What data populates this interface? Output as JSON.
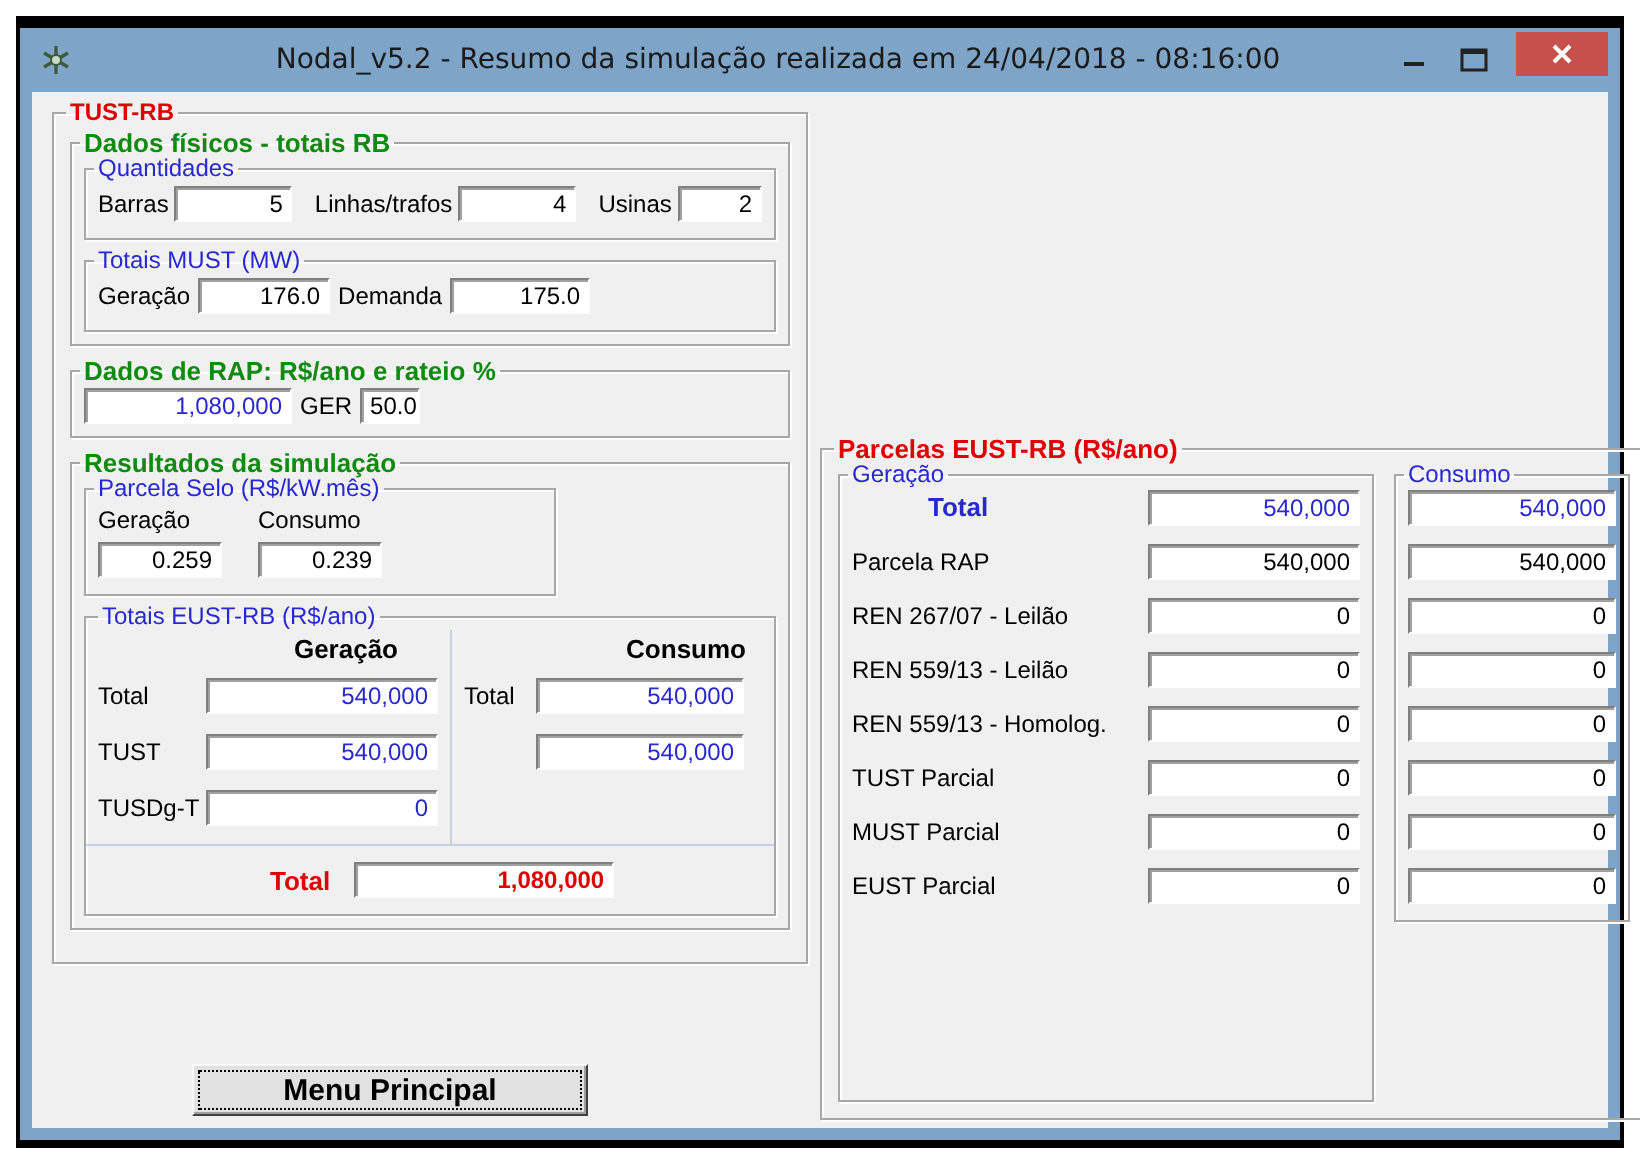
{
  "window": {
    "title": "Nodal_v5.2 - Resumo da simulação realizada em 24/04/2018 - 08:16:00"
  },
  "tust_rb": {
    "title": "TUST-RB",
    "dados_fisicos": {
      "title": "Dados físicos - totais RB",
      "quantidades": {
        "title": "Quantidades",
        "fields": [
          {
            "label": "Barras",
            "value": "5"
          },
          {
            "label": "Linhas/trafos",
            "value": "4"
          },
          {
            "label": "Usinas",
            "value": "2"
          }
        ]
      },
      "totais_must": {
        "title": "Totais MUST (MW)",
        "fields": [
          {
            "label": "Geração",
            "value": "176.0"
          },
          {
            "label": "Demanda",
            "value": "175.0"
          }
        ]
      }
    },
    "dados_rap": {
      "title": "Dados de RAP: R$/ano e rateio %",
      "value": "1,080,000",
      "ger_label": "GER",
      "ger_value": "50.0"
    },
    "resultados": {
      "title": "Resultados da simulação",
      "parcela_selo": {
        "title": "Parcela Selo (R$/kW.mês)",
        "columns": [
          {
            "label": "Geração",
            "value": "0.259"
          },
          {
            "label": "Consumo",
            "value": "0.239"
          }
        ]
      },
      "totais_eust": {
        "title": "Totais EUST-RB  (R$/ano)",
        "geracao": {
          "heading": "Geração",
          "rows": [
            {
              "label": "Total",
              "value": "540,000"
            },
            {
              "label": "TUST",
              "value": "540,000"
            },
            {
              "label": "TUSDg-T",
              "value": "0"
            }
          ]
        },
        "consumo": {
          "heading": "Consumo",
          "rows": [
            {
              "label": "Total",
              "value": "540,000"
            },
            {
              "value": "540,000"
            }
          ]
        },
        "total": {
          "label": "Total",
          "value": "1,080,000"
        }
      }
    }
  },
  "parcelas": {
    "title": "Parcelas EUST-RB (R$/ano)",
    "geracao": {
      "title": "Geração",
      "rows": [
        {
          "kind": "total",
          "label": "Total",
          "value": "540,000"
        },
        {
          "kind": "item",
          "label": "Parcela RAP",
          "value": "540,000"
        },
        {
          "kind": "item",
          "label": "REN 267/07 - Leilão",
          "value": "0"
        },
        {
          "kind": "item",
          "label": "REN 559/13 - Leilão",
          "value": "0"
        },
        {
          "kind": "item",
          "label": "REN 559/13 - Homolog.",
          "value": "0"
        },
        {
          "kind": "item",
          "label": "TUST Parcial",
          "value": "0"
        },
        {
          "kind": "item",
          "label": "MUST Parcial",
          "value": "0"
        },
        {
          "kind": "item",
          "label": "EUST Parcial",
          "value": "0"
        }
      ]
    },
    "consumo": {
      "title": "Consumo",
      "rows": [
        {
          "kind": "total",
          "value": "540,000"
        },
        {
          "kind": "item",
          "value": "540,000"
        },
        {
          "kind": "item",
          "value": "0"
        },
        {
          "kind": "item",
          "value": "0"
        },
        {
          "kind": "item",
          "value": "0"
        },
        {
          "kind": "item",
          "value": "0"
        },
        {
          "kind": "item",
          "value": "0"
        },
        {
          "kind": "item",
          "value": "0"
        }
      ]
    }
  },
  "buttons": [
    {
      "label": "Menu Principal"
    }
  ]
}
